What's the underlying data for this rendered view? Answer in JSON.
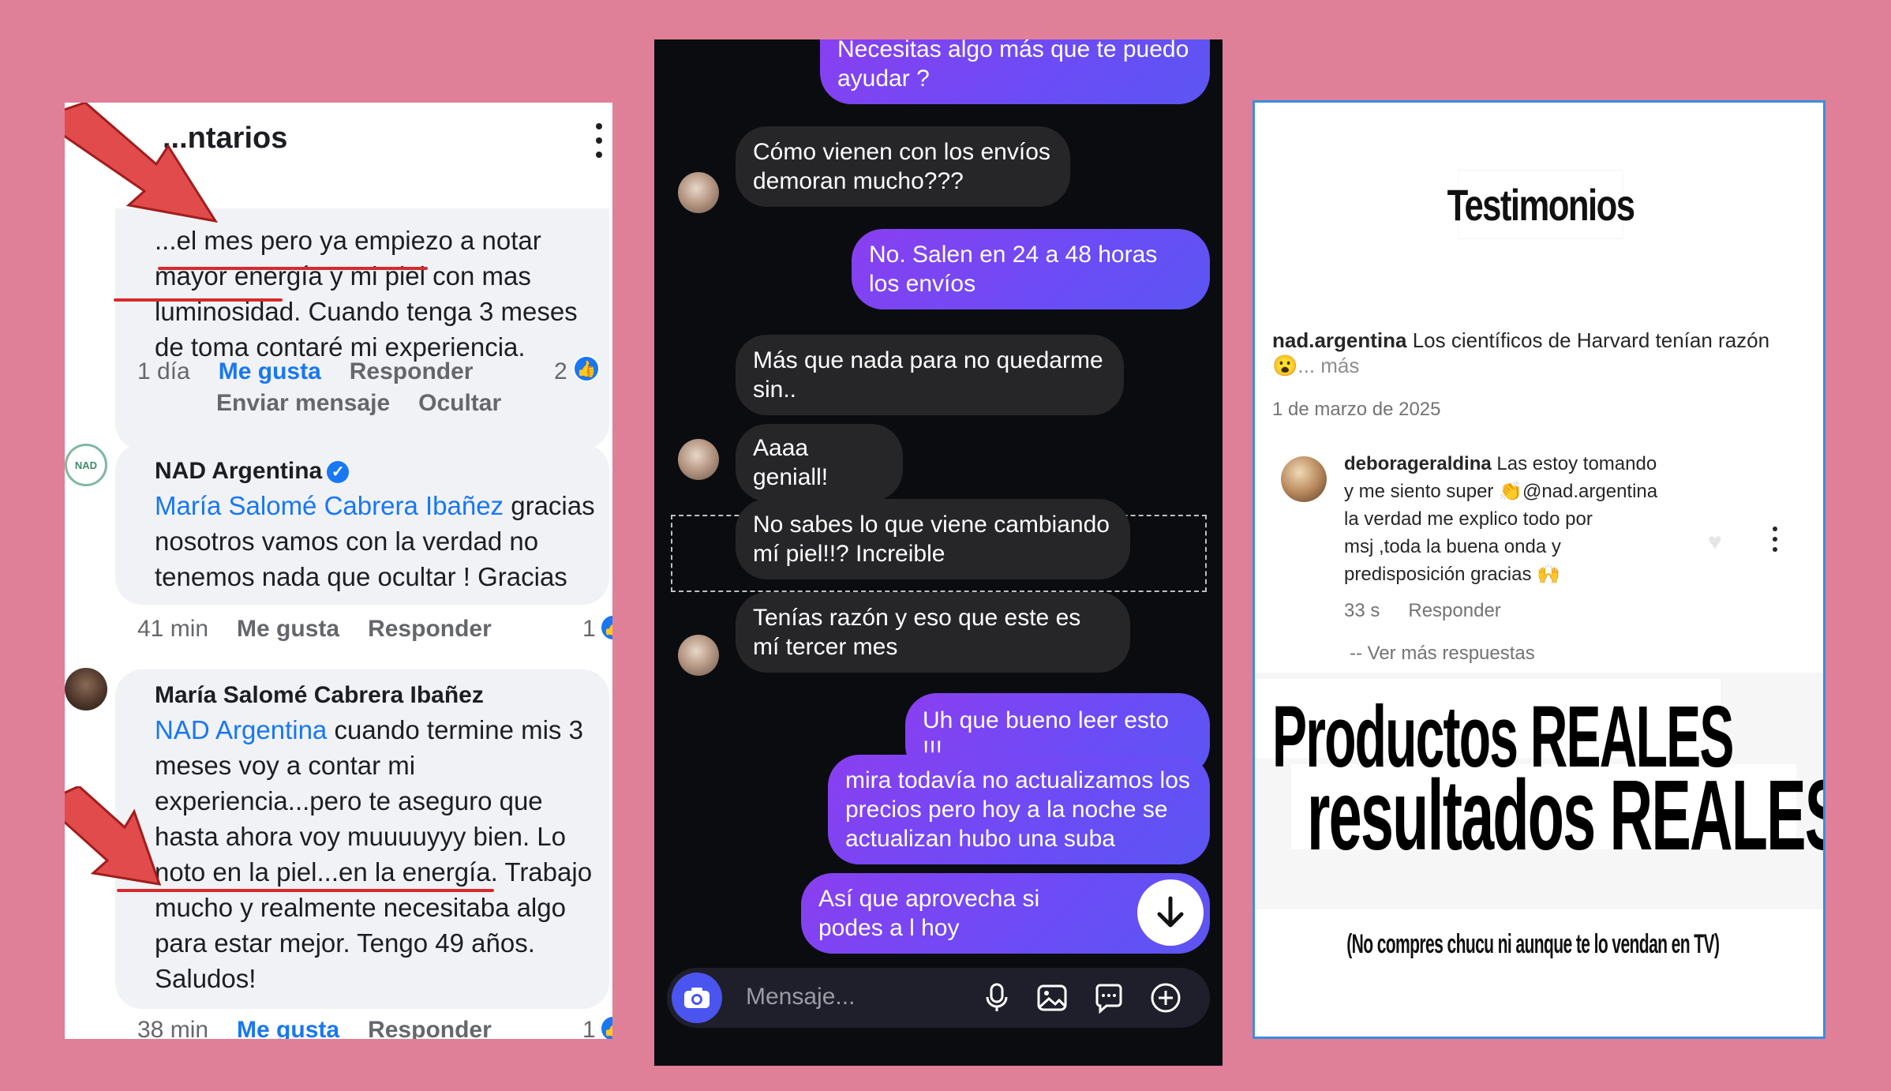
{
  "fb": {
    "header_title": "...ntarios",
    "comment1": {
      "lines": [
        "...el mes pero ya empiezo a notar",
        "mayor energía y mi piel con mas",
        "luminosidad. Cuando tenga 3 meses",
        "de toma contaré mi experiencia."
      ],
      "time": "1 día",
      "like": "Me gusta",
      "reply": "Responder",
      "send_message": "Enviar mensaje",
      "hide": "Ocultar",
      "reactions": "2"
    },
    "comment2": {
      "author": "NAD Argentina",
      "mention": "María Salomé Cabrera Ibañez",
      "text_after_mention": " gracias",
      "lines": [
        "nosotros vamos con la verdad no",
        "tenemos nada que ocultar ! Gracias"
      ],
      "time": "41 min",
      "like": "Me gusta",
      "reply": "Responder",
      "reactions": "1"
    },
    "comment3": {
      "author": "María Salomé Cabrera Ibañez",
      "mention": "NAD Argentina",
      "text_after_mention": " cuando termine mis 3",
      "lines": [
        "meses voy a contar mi",
        "experiencia...pero te aseguro que",
        "hasta ahora voy muuuuyyy bien. Lo",
        "noto en la piel...en la energía. Trabajo",
        "mucho y realmente necesitaba algo",
        "para estar mejor. Tengo 49 años.",
        "Saludos!"
      ],
      "time": "38 min",
      "like": "Me gusta",
      "reply": "Responder",
      "reactions": "1"
    },
    "avatar_label": "NAD"
  },
  "dm": {
    "messages": [
      {
        "dir": "out",
        "text": "Necesitas algo más que te puedo ayudar ?"
      },
      {
        "dir": "in",
        "text": "Cómo vienen con los envíos demoran mucho???"
      },
      {
        "dir": "out",
        "text": "No. Salen en 24 a 48 horas los envíos"
      },
      {
        "dir": "in",
        "text": "Más que nada para no quedarme sin.."
      },
      {
        "dir": "in",
        "text": "Aaaa geniall!"
      },
      {
        "dir": "in",
        "text": "No sabes lo que viene cambiando mí piel!!? Increible"
      },
      {
        "dir": "in",
        "text": "Tenías razón y eso que este es mí tercer mes"
      },
      {
        "dir": "out",
        "text": "Uh que bueno leer esto !!!"
      },
      {
        "dir": "out",
        "text": "mira todavía no actualizamos los precios pero hoy a la noche se actualizan hubo una suba"
      },
      {
        "dir": "out",
        "text": "Así que aprovecha si podes a l hoy"
      }
    ],
    "input_placeholder": "Mensaje..."
  },
  "ig": {
    "title": "Testimonios",
    "caption_user": "nad.argentina",
    "caption_text": " Los científicos de Harvard tenían razón",
    "caption_emoji": "😮",
    "caption_more": "... más",
    "date": "1 de marzo de 2025",
    "comment_user": "deborageraldina",
    "comment_lines": [
      " Las estoy tomando",
      "y me siento super 👏@nad.argentina",
      "la verdad me explico todo por",
      "msj ,toda la buena onda y",
      "predisposición  gracias 🙌"
    ],
    "comment_time": "33 s",
    "comment_reply": "Responder",
    "more_replies": "-- Ver más respuestas",
    "banner_line1": "Productos REALES",
    "banner_line2": "resultados REALES",
    "footer": "(No compres chucu ni aunque te lo vendan en TV)"
  },
  "colors": {
    "background": "#e07f98",
    "fb_link": "#1877f2",
    "dm_outgoing": "#7a45f2",
    "dm_incoming": "#262629",
    "underline_red": "#d62b2b"
  }
}
